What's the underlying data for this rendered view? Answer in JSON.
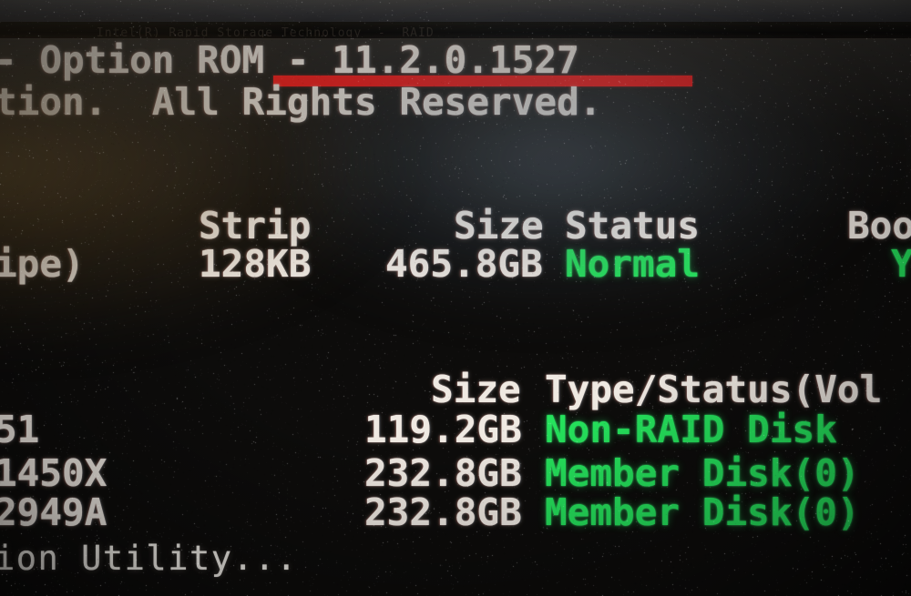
{
  "screen": {
    "kind": "bios-option-rom-screen",
    "colors": {
      "text": "#efe9e2",
      "status_green": "#25e35c",
      "annotation_red": "#f50a0a",
      "background": "#0d0c0b"
    }
  },
  "header": {
    "ghost_line": "            Intel(R) Rapid Storage Technology  -  RAID",
    "title_line": "- Option ROM - 11.2.0.1527",
    "copyright_line": "tion.  All Rights Reserved.",
    "version": "11.2.0.1527"
  },
  "annotation": {
    "type": "red-underline",
    "target": "11.2.0.1527"
  },
  "volumes": {
    "headers": {
      "strip": "Strip",
      "size": "Size",
      "status": "Status",
      "bootable": "Boo"
    },
    "rows": [
      {
        "name": "ipe)",
        "strip": "128KB",
        "size": "465.8GB",
        "status": "Normal",
        "bootable": "Y"
      }
    ]
  },
  "disks": {
    "headers": {
      "size": "Size",
      "type_status": "Type/Status(Vol"
    },
    "rows": [
      {
        "serial": "51",
        "size": "119.2GB",
        "type_status": "Non-RAID Disk"
      },
      {
        "serial": "1450X",
        "size": "232.8GB",
        "type_status": "Member Disk(0)"
      },
      {
        "serial": "2949A",
        "size": "232.8GB",
        "type_status": "Member Disk(0)"
      }
    ]
  },
  "footer": {
    "status_line": "ion Utility..."
  }
}
